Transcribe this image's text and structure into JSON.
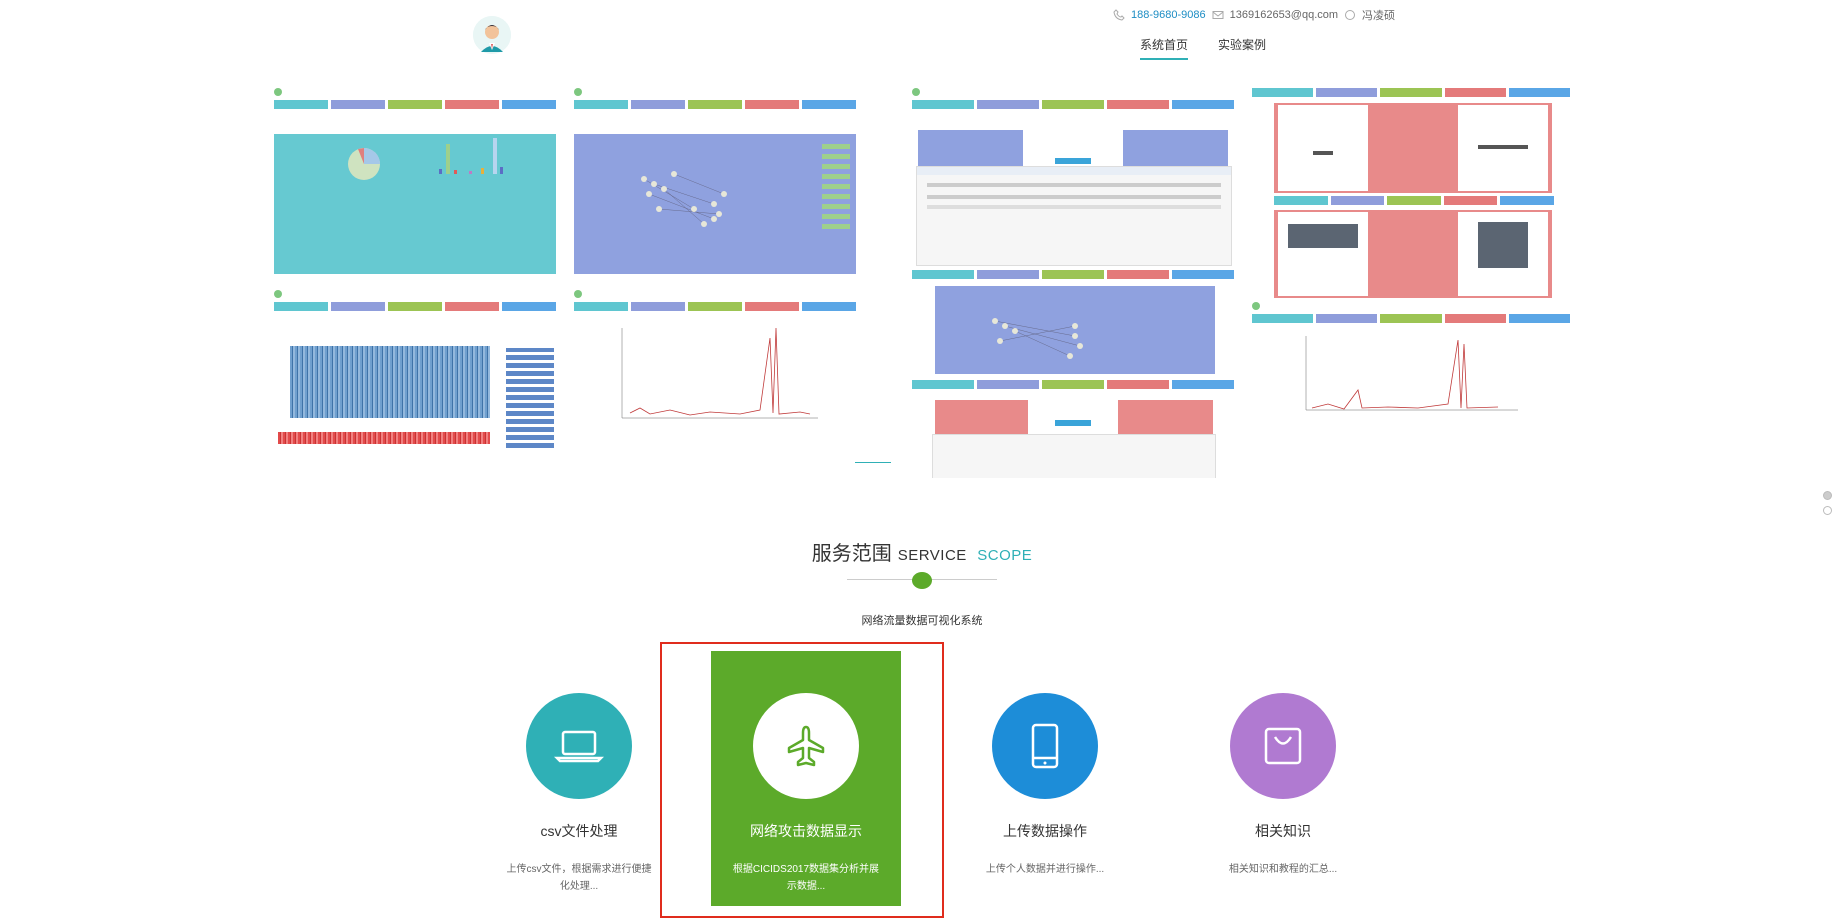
{
  "header": {
    "phone": "188-9680-9086",
    "email": "1369162653@qq.com",
    "name": "冯凌硕",
    "nav": [
      {
        "label": "系统首页",
        "active": true
      },
      {
        "label": "实验案例",
        "active": false
      }
    ]
  },
  "service": {
    "title_cn": "服务范围",
    "title_en_1": "SERVICE",
    "title_en_2": "SCOPE",
    "subtitle": "网络流量数据可视化系统",
    "cards": [
      {
        "title": "csv文件处理",
        "desc": "上传csv文件，根据需求进行便捷化处理...",
        "icon": "laptop-icon",
        "color": "#2fb0b6"
      },
      {
        "title": "网络攻击数据显示",
        "desc": "根据CICIDS2017数据集分析并展示数据...",
        "icon": "airplane-icon",
        "color": "#5caa2a"
      },
      {
        "title": "上传数据操作",
        "desc": "上传个人数据并进行操作...",
        "icon": "phone-icon",
        "color": "#1d8dd8"
      },
      {
        "title": "相关知识",
        "desc": "相关知识和教程的汇总...",
        "icon": "bag-icon",
        "color": "#b07ad1"
      }
    ]
  }
}
